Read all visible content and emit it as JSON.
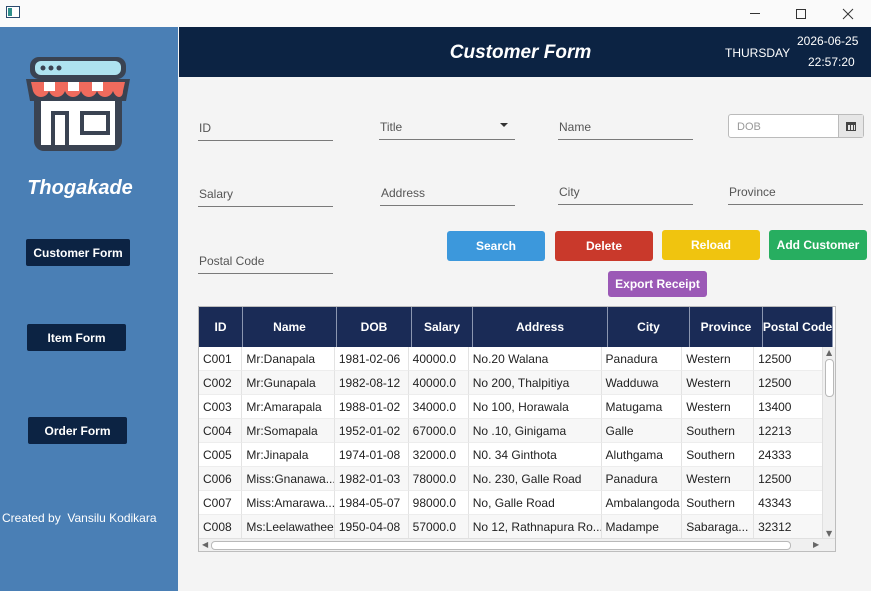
{
  "window": {
    "controls": {
      "minimize": "minimize",
      "maximize": "maximize",
      "close": "close"
    }
  },
  "sidebar": {
    "brand": "Thogakade",
    "nav": [
      "Customer Form",
      "Item Form",
      "Order Form"
    ],
    "credit": "Created by  Vansilu Kodikara"
  },
  "header": {
    "title": "Customer Form",
    "day": "THURSDAY",
    "date": "2026-06-25",
    "time": "22:57:20"
  },
  "form": {
    "id_placeholder": "ID",
    "title_placeholder": "Title",
    "name_placeholder": "Name",
    "dob_placeholder": "DOB",
    "salary_placeholder": "Salary",
    "address_placeholder": "Address",
    "city_placeholder": "City",
    "province_placeholder": "Province",
    "postal_placeholder": "Postal Code"
  },
  "actions": {
    "search": "Search",
    "delete": "Delete",
    "reload": "Reload",
    "add": "Add Customer",
    "export": "Export Receipt"
  },
  "colors": {
    "sidebar": "#4a7fb5",
    "header": "#0c2343",
    "table_header": "#1a2b56",
    "search": "#3c98dc",
    "delete": "#c9392b",
    "reload": "#f0c40f",
    "add": "#27ae60",
    "export": "#9b59b6"
  },
  "table": {
    "columns": [
      "ID",
      "Name",
      "DOB",
      "Salary",
      "Address",
      "City",
      "Province",
      "Postal Code"
    ],
    "rows": [
      [
        "C001",
        "Mr:Danapala",
        "1981-02-06",
        "40000.0",
        "No.20 Walana",
        "Panadura",
        "Western",
        "12500"
      ],
      [
        "C002",
        "Mr:Gunapala",
        "1982-08-12",
        "40000.0",
        "No 200, Thalpitiya",
        "Wadduwa",
        "Western",
        "12500"
      ],
      [
        "C003",
        "Mr:Amarapala",
        "1988-01-02",
        "34000.0",
        "No 100, Horawala",
        "Matugama",
        "Western",
        "13400"
      ],
      [
        "C004",
        "Mr:Somapala",
        "1952-01-02",
        "67000.0",
        "No .10, Ginigama",
        "Galle",
        "Southern",
        "12213"
      ],
      [
        "C005",
        "Mr:Jinapala",
        "1974-01-08",
        "32000.0",
        "N0. 34 Ginthota",
        "Aluthgama",
        "Southern",
        "24333"
      ],
      [
        "C006",
        "Miss:Gnanawa...",
        "1982-01-03",
        "78000.0",
        "No. 230, Galle Road",
        "Panadura",
        "Western",
        "12500"
      ],
      [
        "C007",
        "Miss:Amarawa...",
        "1984-05-07",
        "98000.0",
        "No, Galle Road",
        "Ambalangoda",
        "Southern",
        "43343"
      ],
      [
        "C008",
        "Ms:Leelawathee",
        "1950-04-08",
        "57000.0",
        "No 12, Rathnapura Ro...",
        "Madampe",
        "Sabaraga...",
        "32312"
      ]
    ]
  }
}
